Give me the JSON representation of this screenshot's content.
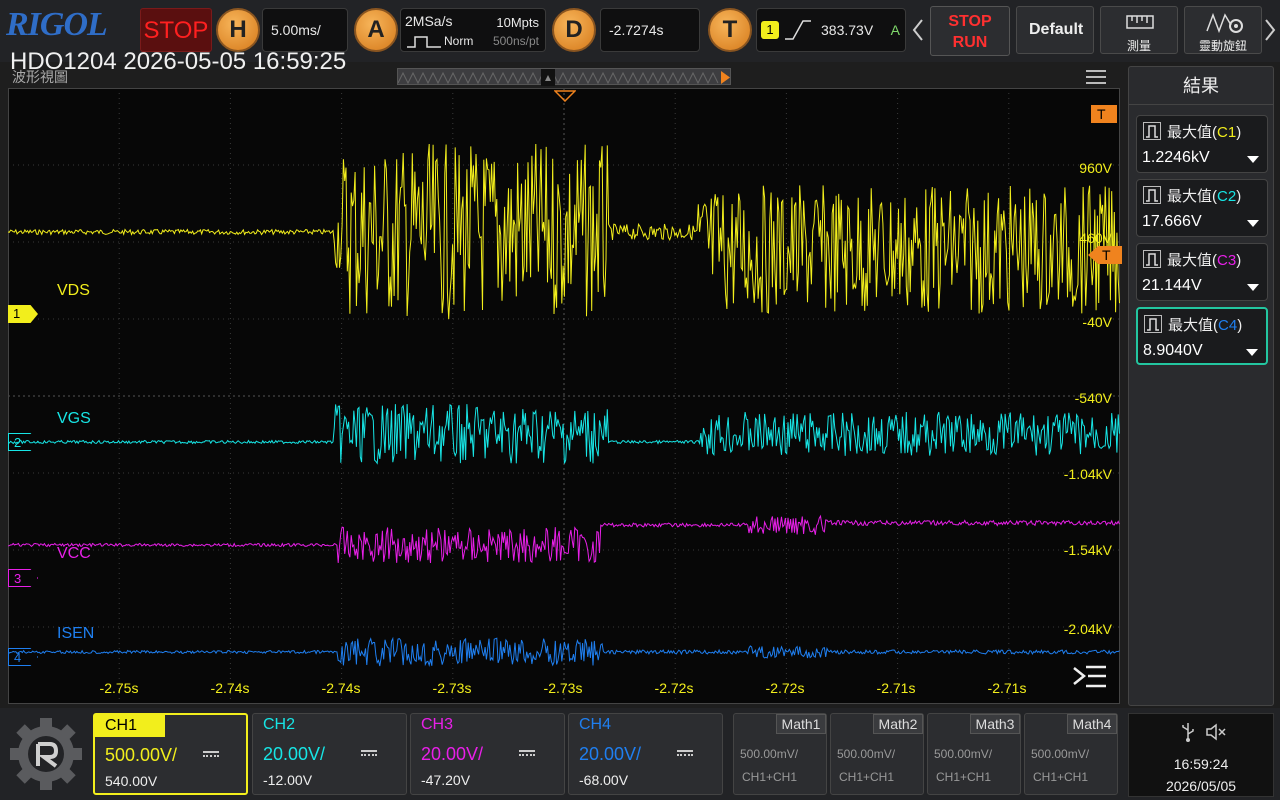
{
  "top": {
    "logo": "RIGOL",
    "run_state": "STOP",
    "horizontal": {
      "key": "H",
      "value": "5.00ms/"
    },
    "acquire": {
      "key": "A",
      "sample_rate": "2MSa/s",
      "memory": "10Mpts",
      "mode": "Norm",
      "resolution": "500ns/pt"
    },
    "delay": {
      "key": "D",
      "value": "-2.7274s"
    },
    "trigger": {
      "key": "T",
      "source": "1",
      "level": "383.73V",
      "mode": "A"
    },
    "run_stop_top": "STOP",
    "run_stop_bottom": "RUN",
    "default_label": "Default",
    "measure_label": "測量",
    "knob_label": "靈動旋鈕"
  },
  "header": {
    "model_time": "HDO1204 2026-05-05 16:59:25",
    "view_label": "波形視圖"
  },
  "scope": {
    "channels": [
      {
        "num": "1",
        "name": "VDS",
        "color": "#f2ee1c"
      },
      {
        "num": "2",
        "name": "VGS",
        "color": "#17e5e5"
      },
      {
        "num": "3",
        "name": "VCC",
        "color": "#e820e8"
      },
      {
        "num": "4",
        "name": "ISEN",
        "color": "#1f7ff0"
      }
    ],
    "vlabels": [
      "960V",
      "460V",
      "-40V",
      "-540V",
      "-1.04kV",
      "-1.54kV",
      "-2.04kV"
    ],
    "xlabels": [
      "-2.75s",
      "-2.74s",
      "-2.74s",
      "-2.73s",
      "-2.73s",
      "-2.72s",
      "-2.72s",
      "-2.71s",
      "-2.71s"
    ],
    "trigger_marker": "T"
  },
  "results": {
    "title": "結果",
    "items": [
      {
        "label": "最大值",
        "src": "C1",
        "value": "1.2246kV",
        "color": "#f2ee1c"
      },
      {
        "label": "最大值",
        "src": "C2",
        "value": "17.666V",
        "color": "#17e5e5"
      },
      {
        "label": "最大值",
        "src": "C3",
        "value": "21.144V",
        "color": "#e820e8"
      },
      {
        "label": "最大值",
        "src": "C4",
        "value": "8.9040V",
        "color": "#1f7ff0"
      }
    ]
  },
  "bottom": {
    "channels": [
      {
        "name": "CH1",
        "scale": "500.00V/",
        "offset": "540.00V",
        "color": "#f2ee1c"
      },
      {
        "name": "CH2",
        "scale": "20.00V/",
        "offset": "-12.00V",
        "color": "#17e5e5"
      },
      {
        "name": "CH3",
        "scale": "20.00V/",
        "offset": "-47.20V",
        "color": "#e820e8"
      },
      {
        "name": "CH4",
        "scale": "20.00V/",
        "offset": "-68.00V",
        "color": "#1f7ff0"
      }
    ],
    "math": [
      {
        "name": "Math1",
        "line1": "500.00mV/",
        "line2": "CH1+CH1"
      },
      {
        "name": "Math2",
        "line1": "500.00mV/",
        "line2": "CH1+CH1"
      },
      {
        "name": "Math3",
        "line1": "500.00mV/",
        "line2": "CH1+CH1"
      },
      {
        "name": "Math4",
        "line1": "500.00mV/",
        "line2": "CH1+CH1"
      }
    ],
    "time": "16:59:24",
    "date": "2026/05/05"
  }
}
